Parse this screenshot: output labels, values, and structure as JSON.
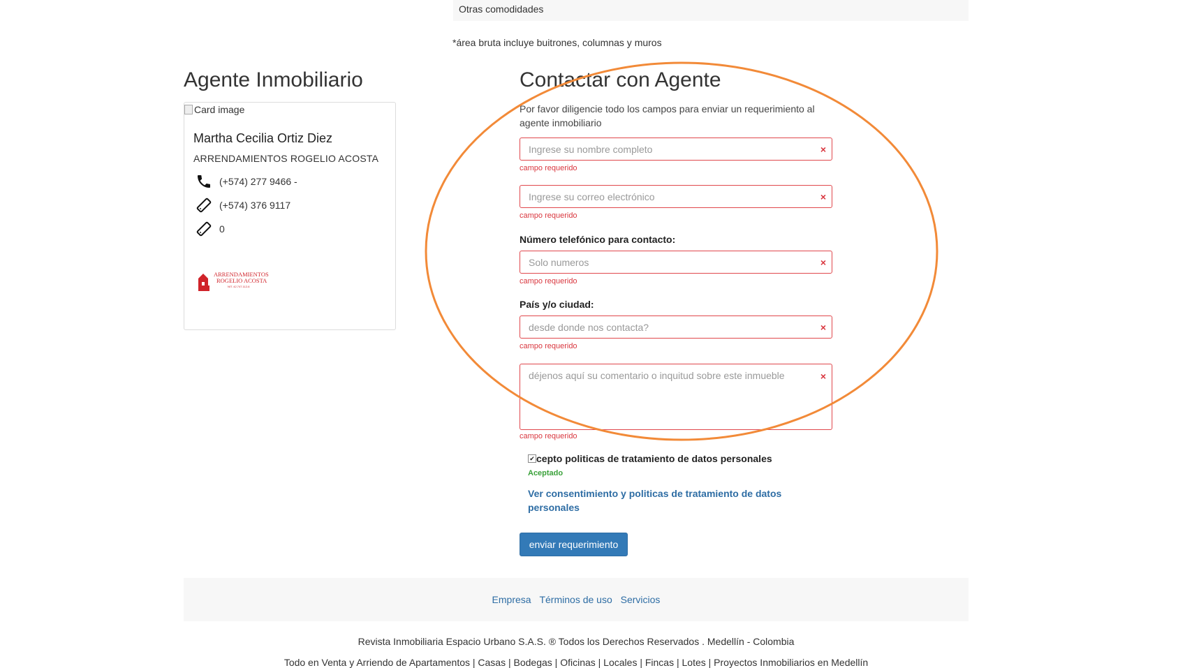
{
  "property": {
    "amenities_label": "Otras comodidades",
    "area_note": "*área bruta incluye buitrones, columnas y muros"
  },
  "agent": {
    "section_title": "Agente Inmobiliario",
    "image_alt": "Card image",
    "name": "Martha Cecilia Ortiz Diez",
    "company": "ARRENDAMIENTOS ROGELIO ACOSTA",
    "phones": [
      {
        "icon": "phone-icon",
        "value": "(+574) 277 9466 -"
      },
      {
        "icon": "mobile-icon",
        "value": "(+574) 376 9117"
      },
      {
        "icon": "mobile-icon",
        "value": "0"
      }
    ],
    "logo": {
      "line1": "ARRENDAMIENTOS",
      "line2": "ROGELIO ACOSTA",
      "line3": "NIT. 42.747.112-6",
      "color": "#d0232a"
    }
  },
  "contact": {
    "section_title": "Contactar con Agente",
    "intro": "Por favor diligencie todo los campos para enviar un requerimiento al agente inmobiliario",
    "name_placeholder": "Ingrese su nombre completo",
    "email_placeholder": "Ingrese su correo electrónico",
    "phone_label": "Número telefónico para contacto:",
    "phone_placeholder": "Solo numeros",
    "city_label": "País y/o ciudad:",
    "city_placeholder": "desde donde nos contacta?",
    "comment_placeholder": "déjenos aquí su comentario o inquitud sobre este inmueble",
    "required_msg": "campo requerido",
    "clear_symbol": "×",
    "consent_label": "cepto politicas de tratamiento de datos personales",
    "consent_checked": true,
    "accepted_label": "Aceptado",
    "policy_link": "Ver consentimiento y politicas de tratamiento de datos personales",
    "submit_label": "enviar requerimiento",
    "error_color": "#d9363e",
    "accent_color": "#337ab7"
  },
  "footer": {
    "links": [
      "Empresa",
      "Términos de uso",
      "Servicios"
    ],
    "copyright": "Revista Inmobiliaria Espacio Urbano S.A.S. ® Todos los Derechos Reservados . Medellín - Colombia",
    "services_line": "Todo en Venta y Arriendo de Apartamentos | Casas | Bodegas | Oficinas | Locales | Fincas | Lotes | Proyectos Inmobiliarios en Medellín"
  },
  "annotation": {
    "shape": "ellipse",
    "color": "#f28a38"
  }
}
